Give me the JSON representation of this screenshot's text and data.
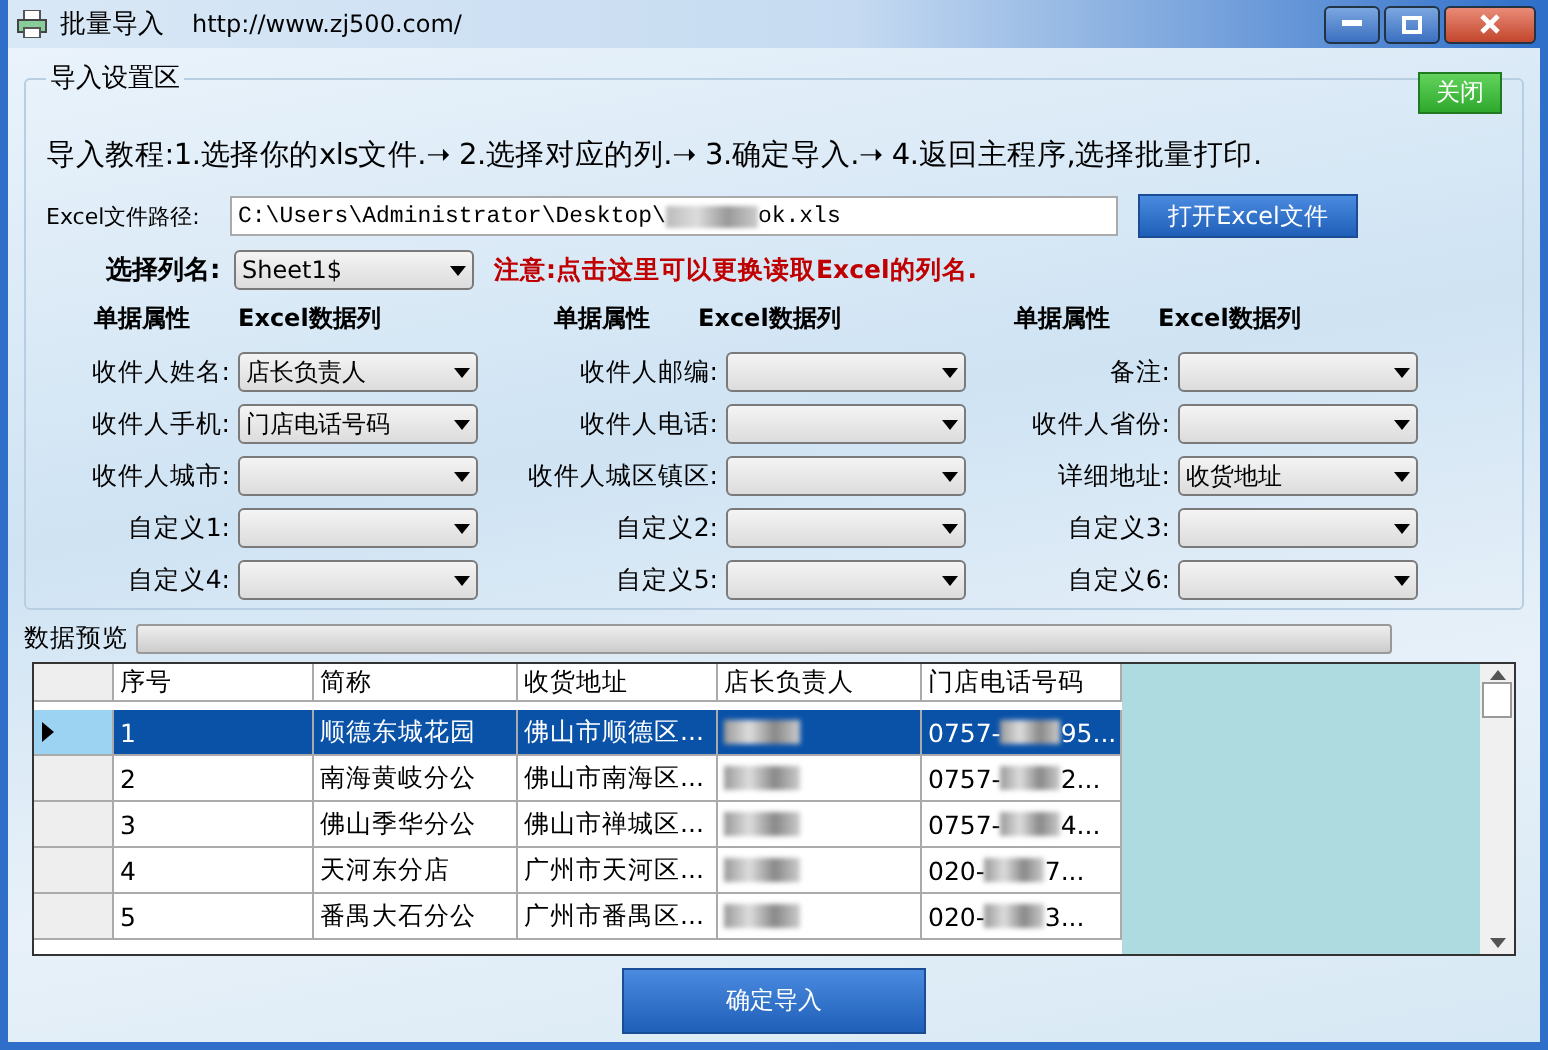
{
  "window": {
    "title": "批量导入",
    "url": "http://www.zj500.com/"
  },
  "settings": {
    "legend": "导入设置区",
    "close_button": "关闭",
    "tutorial": "导入教程:1.选择你的xls文件.➝ 2.选择对应的列.➝ 3.确定导入.➝ 4.返回主程序,选择批量打印.",
    "file_path": {
      "label": "Excel文件路径:",
      "value_start": "C:\\Users\\Administrator\\Desktop\\",
      "value_end": "ok.xls",
      "button": "打开Excel文件"
    },
    "sheet": {
      "label": "选择列名:",
      "value": "Sheet1$",
      "notice": "注意:点击这里可以更换读取Excel的列名."
    },
    "column_headers": [
      {
        "field": "单据属性",
        "column": "Excel数据列"
      },
      {
        "field": "单据属性",
        "column": "Excel数据列"
      },
      {
        "field": "单据属性",
        "column": "Excel数据列"
      }
    ],
    "mappings": [
      [
        {
          "label": "收件人姓名:",
          "value": "店长负责人"
        },
        {
          "label": "收件人邮编:"
        },
        {
          "label": "备注:"
        }
      ],
      [
        {
          "label": "收件人手机:",
          "value": "门店电话号码"
        },
        {
          "label": "收件人电话:"
        },
        {
          "label": "收件人省份:"
        }
      ],
      [
        {
          "label": "收件人城市:"
        },
        {
          "label": "收件人城区镇区:"
        },
        {
          "label": "详细地址:",
          "value": "收货地址"
        }
      ],
      [
        {
          "label": "自定义1:"
        },
        {
          "label": "自定义2:"
        },
        {
          "label": "自定义3:"
        }
      ],
      [
        {
          "label": "自定义4:"
        },
        {
          "label": "自定义5:"
        },
        {
          "label": "自定义6:"
        }
      ]
    ]
  },
  "preview": {
    "legend": "数据预览",
    "progress": {
      "level": 0
    },
    "table": {
      "columns": [
        "序号",
        "简称",
        "收货地址",
        "店长负责人",
        "门店电话号码"
      ],
      "rows": [
        {
          "selected": true,
          "cells": [
            "1",
            "顺德东城花园",
            "佛山市顺德区..."
          ],
          "phone_prefix": "0757-",
          "phone_suffix": "95..."
        },
        {
          "selected": false,
          "cells": [
            "2",
            "南海黄岐分公",
            "佛山市南海区..."
          ],
          "phone_prefix": "0757-",
          "phone_suffix": "2..."
        },
        {
          "selected": false,
          "cells": [
            "3",
            "佛山季华分公",
            "佛山市禅城区..."
          ],
          "phone_prefix": "0757-",
          "phone_suffix": "4..."
        },
        {
          "selected": false,
          "cells": [
            "4",
            "天河东分店",
            "广州市天河区..."
          ],
          "phone_prefix": "020-",
          "phone_suffix": "7..."
        },
        {
          "selected": false,
          "cells": [
            "5",
            "番禺大石分公",
            "广州市番禺区..."
          ],
          "phone_prefix": "020-",
          "phone_suffix": "3..."
        }
      ]
    }
  },
  "confirm_button": "确定导入"
}
